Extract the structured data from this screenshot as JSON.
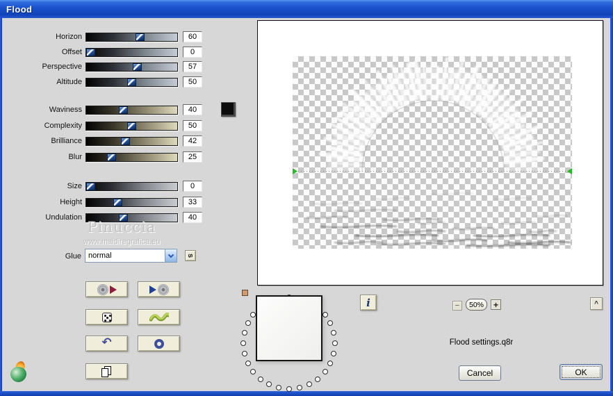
{
  "window": {
    "title": "Flood"
  },
  "sliders": {
    "group1": [
      {
        "label": "Horizon",
        "value": 60
      },
      {
        "label": "Offset",
        "value": 0
      },
      {
        "label": "Perspective",
        "value": 57
      },
      {
        "label": "Altitude",
        "value": 50
      }
    ],
    "group2": [
      {
        "label": "Waviness",
        "value": 40
      },
      {
        "label": "Complexity",
        "value": 50
      },
      {
        "label": "Brilliance",
        "value": 42
      },
      {
        "label": "Blur",
        "value": 25
      }
    ],
    "group3": [
      {
        "label": "Size",
        "value": 0
      },
      {
        "label": "Height",
        "value": 33
      },
      {
        "label": "Undulation",
        "value": 40
      }
    ]
  },
  "swatch_color": "#0c0c0c",
  "glue": {
    "label": "Glue",
    "selected": "normal",
    "style_button": "s"
  },
  "watermark": {
    "name": "Pinuccia",
    "site": "www.maidiregrafica.eu"
  },
  "preview": {
    "zoom_out": "−",
    "zoom_level": "50%",
    "zoom_in": "+",
    "info": "i",
    "expand": "^"
  },
  "footer": {
    "settings_file": "Flood settings.q8r",
    "cancel": "Cancel",
    "ok": "OK"
  },
  "colors": {
    "titlebar_blue": "#1a50cc",
    "horizon_marker_green": "#22bb22",
    "handle_blue": "#24509a"
  }
}
